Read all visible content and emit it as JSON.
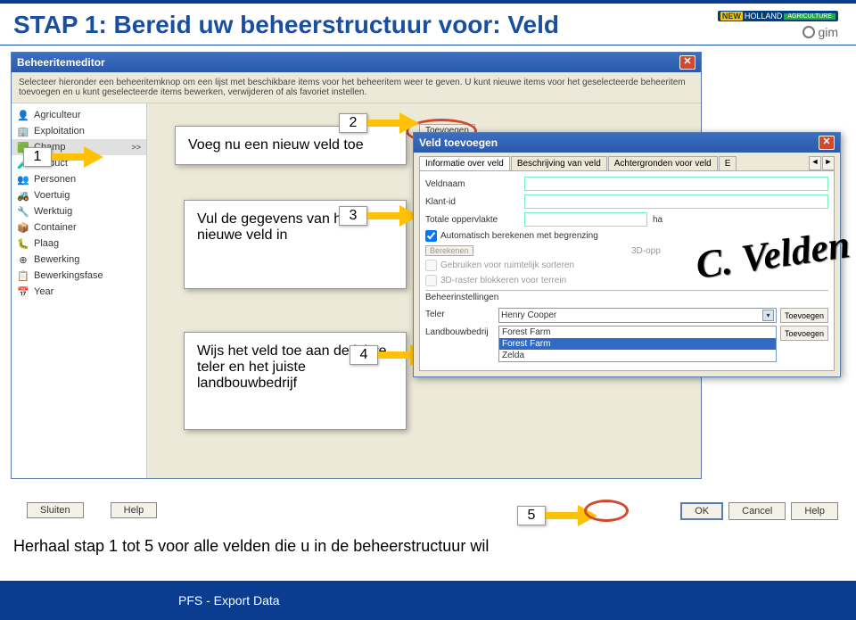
{
  "page_title": "STAP 1: Bereid uw beheerstructuur voor: Veld",
  "logos": {
    "nh1": "NEW",
    "nh2": "HOLLAND",
    "nh3": "AGRICULTURE",
    "gim": "gim"
  },
  "editor": {
    "title": "Beheeritemeditor",
    "desc": "Selecteer hieronder een beheeritemknop om een lijst met beschikbare items voor het beheeritem weer te geven. U kunt nieuwe items voor het geselecteerde beheeritem toevoegen en u kunt geselecteerde items bewerken, verwijderen of als favoriet instellen.",
    "sidebar": [
      "Agriculteur",
      "Exploitation",
      "Champ",
      "Product",
      "Personen",
      "Voertuig",
      "Werktuig",
      "Container",
      "Plaag",
      "Bewerking",
      "Bewerkingsfase",
      "Year"
    ],
    "toolbar": [
      "Toevoegen"
    ]
  },
  "overlay1": "Voeg nu een nieuw veld toe",
  "overlay2": "Vul de gegevens van het nieuwe veld in",
  "overlay3": "Wijs het veld toe aan de juiste teler en het juiste landbouwbedrijf",
  "nums": {
    "n1": "1",
    "n2": "2",
    "n3": "3",
    "n4": "4",
    "n5": "5"
  },
  "add": {
    "title": "Veld toevoegen",
    "tabs": [
      "Informatie over veld",
      "Beschrijving van veld",
      "Achtergronden voor veld",
      "E"
    ],
    "fields": {
      "name_lbl": "Veldnaam",
      "client_lbl": "Klant-id",
      "area_lbl": "Totale oppervlakte",
      "area_unit": "ha",
      "auto_lbl": "Automatisch berekenen met begrenzing",
      "calc_lbl": "Berekenen",
      "d3_lbl": "3D-opp",
      "sort_lbl": "Gebruiken voor ruimtelijk sorteren",
      "block_lbl": "3D-raster blokkeren voor terrein",
      "group_lbl": "Beheerinstellingen",
      "grower_lbl": "Teler",
      "grower_val": "Henry Cooper",
      "farm_lbl": "Landbouwbedrij",
      "farm_opts": [
        "Forest Farm",
        "Forest Farm",
        "Zelda"
      ],
      "add_btn": "Toevoegen"
    }
  },
  "velden": "C. Velden",
  "buttons": {
    "sluiten": "Sluiten",
    "help": "Help",
    "ok": "OK",
    "cancel": "Cancel"
  },
  "repeat": "Herhaal stap 1 tot 5 voor alle velden die u in de beheerstructuur wil",
  "footer": "PFS  -  Export Data"
}
